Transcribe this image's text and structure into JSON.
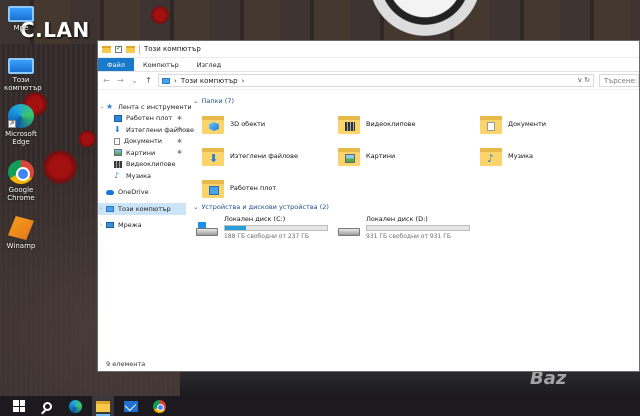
{
  "watermarks": {
    "top_left": "C.LAN",
    "bottom_right": "Baz"
  },
  "desktop_icons": [
    {
      "label": "Мре",
      "icon": "pc-icon"
    },
    {
      "label": "Този компютър",
      "icon": "pc-icon"
    },
    {
      "label": "Microsoft Edge",
      "icon": "edge-icon"
    },
    {
      "label": "Google Chrome",
      "icon": "chrome-icon"
    },
    {
      "label": "Winamp",
      "icon": "winamp-icon"
    }
  ],
  "window": {
    "title": "Този компютър",
    "ribbon_tabs": [
      "Файл",
      "Компютър",
      "Изглед"
    ],
    "address_path": "Този компютър",
    "address_chevron": "›",
    "address_right": "v ↻",
    "search_placeholder": "Търсене: Този ...",
    "nav": {
      "back": "←",
      "forward": "→",
      "recent": "⌄",
      "up": "↑",
      "quick_access": "Лента с инструменти",
      "quick_items": [
        {
          "label": "Работен плот",
          "icon": "desktop-icon",
          "pinned": true
        },
        {
          "label": "Изтеглени файлове",
          "icon": "download-icon",
          "pinned": true
        },
        {
          "label": "Документи",
          "icon": "document-icon",
          "pinned": true
        },
        {
          "label": "Картини",
          "icon": "picture-icon",
          "pinned": true
        },
        {
          "label": "Видеоклипове",
          "icon": "video-icon",
          "pinned": false
        },
        {
          "label": "Музика",
          "icon": "music-icon",
          "pinned": false
        }
      ],
      "onedrive": "OneDrive",
      "this_pc": "Този компютър",
      "network": "Мрежа",
      "pin_glyph": "✱"
    },
    "folders_header": "Папки (7)",
    "folders": [
      {
        "label": "3D обекти",
        "badge": "3d"
      },
      {
        "label": "Видеоклипове",
        "badge": "vid"
      },
      {
        "label": "Документи",
        "badge": "doc"
      },
      {
        "label": "Изтеглени файлове",
        "badge": "down"
      },
      {
        "label": "Картини",
        "badge": "pic"
      },
      {
        "label": "Музика",
        "badge": "music"
      },
      {
        "label": "Работен плот",
        "badge": "desk"
      }
    ],
    "drives_header": "Устройства и дискови устройства (2)",
    "drives": [
      {
        "label": "Локален диск (C:)",
        "free_text": "188 ГБ свободни от 237 ГБ",
        "used_fraction": 0.21,
        "system": true
      },
      {
        "label": "Локален диск (D:)",
        "free_text": "931 ГБ свободни от 931 ГБ",
        "used_fraction": 0.0,
        "system": false
      }
    ],
    "status_text": "9 елемента"
  },
  "taskbar": {
    "items": [
      "start-button",
      "search-button",
      "edge-button",
      "file-explorer-button",
      "mail-button",
      "chrome-button"
    ]
  },
  "colors": {
    "ribbon_file": "#1979ca",
    "selection": "#cce4f7",
    "drive_fill": "#26a0da",
    "taskbar": "#1c1a1f"
  }
}
